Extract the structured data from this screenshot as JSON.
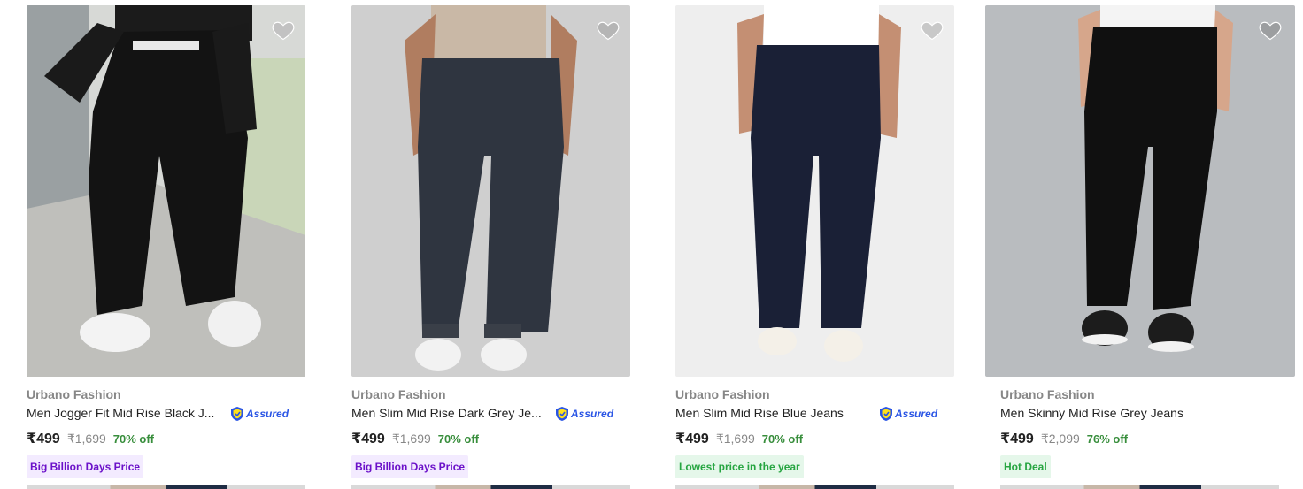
{
  "products": [
    {
      "brand": "Urbano Fashion",
      "title": "Men Jogger Fit Mid Rise Black J...",
      "price": "₹499",
      "mrp": "₹1,699",
      "discount": "70% off",
      "badge": "Big Billion Days Price",
      "badge_style": "purple",
      "assured": true,
      "assured_label": "Assured"
    },
    {
      "brand": "Urbano Fashion",
      "title": "Men Slim Mid Rise Dark Grey Je...",
      "price": "₹499",
      "mrp": "₹1,699",
      "discount": "70% off",
      "badge": "Big Billion Days Price",
      "badge_style": "purple",
      "assured": true,
      "assured_label": "Assured"
    },
    {
      "brand": "Urbano Fashion",
      "title": "Men Slim Mid Rise Blue Jeans",
      "price": "₹499",
      "mrp": "₹1,699",
      "discount": "70% off",
      "badge": "Lowest price in the year",
      "badge_style": "green",
      "assured": true,
      "assured_label": "Assured"
    },
    {
      "brand": "Urbano Fashion",
      "title": "Men Skinny Mid Rise Grey Jeans",
      "price": "₹499",
      "mrp": "₹2,099",
      "discount": "76% off",
      "badge": "Hot Deal",
      "badge_style": "green",
      "assured": false
    }
  ],
  "icons": {
    "wishlist": "heart-icon",
    "assured": "flipkart-assured-shield-icon"
  },
  "colors": {
    "discount": "#388e3c",
    "brand_text": "#878787",
    "assured_blue": "#2a55e5",
    "badge_purple_bg": "#f3ebff",
    "badge_purple_text": "#6b11c9",
    "badge_green_bg": "#e5f7ea",
    "badge_green_text": "#26a541"
  }
}
